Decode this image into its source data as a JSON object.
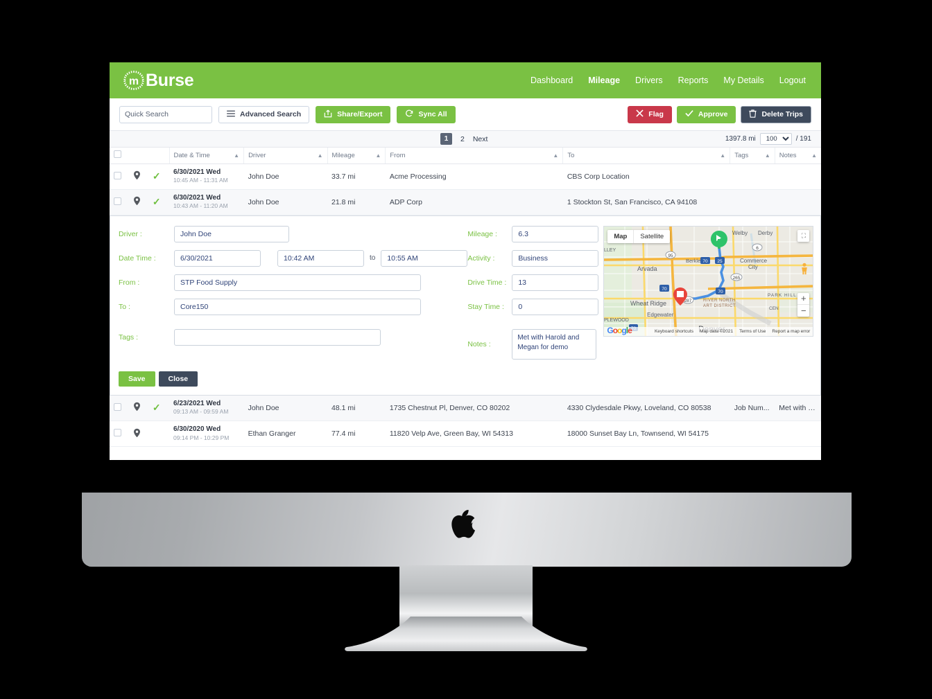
{
  "app": {
    "brand_mark": "m",
    "brand_text": "Burse",
    "brand_color": "#7ac143",
    "accent_navy": "#3e4a5c",
    "danger_color": "#c9384a"
  },
  "nav": {
    "items": [
      {
        "label": "Dashboard",
        "active": false
      },
      {
        "label": "Mileage",
        "active": true
      },
      {
        "label": "Drivers",
        "active": false
      },
      {
        "label": "Reports",
        "active": false
      },
      {
        "label": "My Details",
        "active": false
      },
      {
        "label": "Logout",
        "active": false
      }
    ]
  },
  "toolbar": {
    "search_placeholder": "Quick Search",
    "search_value": "",
    "search_icon": "search-icon",
    "advanced_search_label": "Advanced Search",
    "advanced_search_icon": "hamburger-icon",
    "share_export_label": "Share/Export",
    "share_export_icon": "share-icon",
    "sync_all_label": "Sync All",
    "sync_all_icon": "refresh-icon",
    "flag_label": "Flag",
    "flag_icon": "x-icon",
    "approve_label": "Approve",
    "approve_icon": "check-icon",
    "delete_label": "Delete Trips",
    "delete_icon": "trash-icon"
  },
  "pager": {
    "page_1": "1",
    "page_2": "2",
    "next_label": "Next",
    "total_mileage": "1397.8 mi",
    "page_size": "100",
    "page_size_options": [
      "100"
    ],
    "total_records": "/ 191"
  },
  "table": {
    "headers": [
      {
        "label": "Date & Time",
        "sort_icon": "sort-caret-icon"
      },
      {
        "label": "Driver",
        "sort_icon": "sort-caret-icon"
      },
      {
        "label": "Mileage",
        "sort_icon": "sort-caret-icon"
      },
      {
        "label": "From",
        "sort_icon": "sort-caret-icon"
      },
      {
        "label": "To",
        "sort_icon": "sort-caret-icon"
      },
      {
        "label": "Tags",
        "sort_icon": "sort-caret-icon"
      },
      {
        "label": "Notes",
        "sort_icon": "sort-caret-icon"
      }
    ],
    "rows_top": [
      {
        "date": "6/30/2021 Wed",
        "time": "10:45 AM - 11:31 AM",
        "driver": "John Doe",
        "mileage": "33.7 mi",
        "from": "Acme Processing",
        "to": "CBS Corp Location",
        "tags": "",
        "notes": "",
        "approved": true
      },
      {
        "date": "6/30/2021 Wed",
        "time": "10:43 AM - 11:20 AM",
        "driver": "John Doe",
        "mileage": "21.8 mi",
        "from": "ADP Corp",
        "to": "1 Stockton St, San Francisco, CA 94108",
        "tags": "",
        "notes": "",
        "approved": true
      }
    ],
    "rows_bottom": [
      {
        "date": "6/23/2021 Wed",
        "time": "09:13 AM - 09:59 AM",
        "driver": "John Doe",
        "mileage": "48.1 mi",
        "from": "1735 Chestnut Pl, Denver, CO 80202",
        "to": "4330 Clydesdale Pkwy, Loveland, CO 80538",
        "tags": "Job Num...",
        "notes": "Met with Mik...",
        "approved": true
      },
      {
        "date": "6/30/2020 Wed",
        "time": "09:14 PM - 10:29 PM",
        "driver": "Ethan Granger",
        "mileage": "77.4 mi",
        "from": "11820 Velp Ave, Green Bay, WI 54313",
        "to": "18000 Sunset Bay Ln, Townsend, WI 54175",
        "tags": "",
        "notes": "",
        "approved": false
      }
    ]
  },
  "edit_form": {
    "driver_label": "Driver :",
    "driver_value": "John Doe",
    "datetime_label": "Date Time :",
    "date_value": "6/30/2021",
    "start_time_value": "10:42 AM",
    "to_word": "to",
    "end_time_value": "10:55 AM",
    "from_label": "From :",
    "from_value": "STP Food Supply",
    "to_label": "To :",
    "to_value": "Core150",
    "tags_label": "Tags :",
    "tags_value": "",
    "notes_label": "Notes :",
    "notes_value": "Met with Harold and Megan for demo",
    "mileage_label": "Mileage :",
    "mileage_value": "6.3",
    "activity_label": "Activity :",
    "activity_value": "Business",
    "drive_time_label": "Drive Time :",
    "drive_time_value": "13",
    "stay_time_label": "Stay Time :",
    "stay_time_value": "0",
    "save_label": "Save",
    "close_label": "Close"
  },
  "map": {
    "tab_map": "Map",
    "tab_satellite": "Satellite",
    "expand_icon": "expand-icon",
    "pegman_icon": "street-view-icon",
    "zoom_in": "+",
    "zoom_out": "−",
    "attribution_logo": "Google",
    "keyboard_shortcuts": "Keyboard shortcuts",
    "map_data": "Map data ©2021",
    "terms": "Terms of Use",
    "report": "Report a map error",
    "labels": [
      "Welby",
      "Derby",
      "Berkley",
      "Arvada",
      "Commerce City",
      "Wheat Ridge",
      "Edgewater",
      "Denver",
      "PARK HILL",
      "RIVER NORTH ART DISTRICT",
      "LLEY",
      "PLEWOOD",
      "CEN"
    ],
    "shields": [
      "95",
      "6",
      "70",
      "25",
      "265",
      "287",
      "70"
    ],
    "start_marker": "start-marker",
    "end_marker": "end-marker"
  }
}
